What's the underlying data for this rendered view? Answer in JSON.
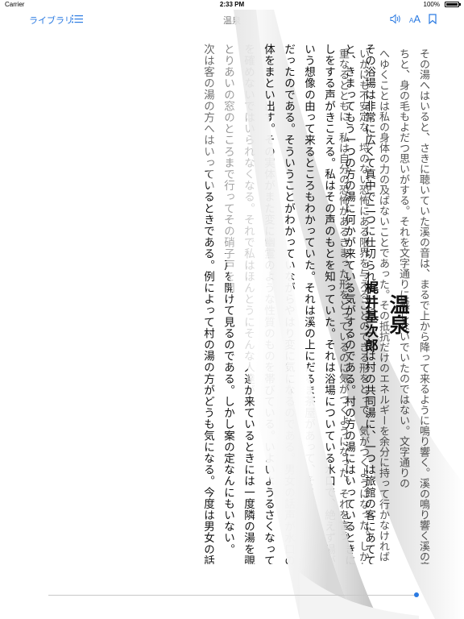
{
  "status": {
    "carrier": "Carrier",
    "time": "2:33 PM",
    "battery": "100%",
    "battery_level": 1.0
  },
  "nav": {
    "library_label": "ライブラリ",
    "title": "温泉",
    "font_label_small": "A",
    "font_label_large": "A"
  },
  "book": {
    "title": "温泉",
    "author": "梶井基次郎",
    "progress": 0.99,
    "lines": [
      "その浴場は非常に広くて真中で二つに仕切られていた。一つは村の共同湯に、一つは旅館の客にあててあった。私がそのどちらかにはいって",
      "と、きまってもう一つの方の湯に何かが来ている気がするのである。村の方の湯にはいっているときには、きまって客の湯の方に男女のぼそぼそ",
      "しをする声がきこえる。私はその声のもとを知っていた。それは浴場についている水口で、絶えず湯がほとばしり出ているのである。また男と",
      "いう想像の由って来るところもわかっていた。それは溪の上にだるま茶屋があって、そこの女が客と夜更けて湯へやって来ることがありうべきこと",
      "だったのである。そういうことがわかっていながらやはり変に気になるのである。男女の話声が水口の水の音だとわかっていながら、不可抗的に実",
      "体をまとい出す。その実体がまた変に幽霊のような性質のものを帯びている。いよいようるさくなって来ると私は自分の顔が変な顔になっていな",
      "を確めないではいられなくなる。それで私はほんとうにそんな人達が来ているときには一度隣の湯を覗いて見ないではいられないようにさえなる。",
      "とりあいの窓のところまで行ってその硝子戸を開けて見るのである。しかし案の定なんにもいない。",
      "次は客の湯の方へはいっているときである。例によって村の湯の方がどうも気になる。今度は男女の話声ではない。気になるのはさっきの溪への"
    ],
    "back_lines": [
      "その湯へはいると、さきに聴いていた溪の音は、まるで上から降って来るように鳴り響く。溪の鳴り響く溪の音ばかりが耳について、",
      "ちと、身の毛もよだつ思いがする。それを文字通りに感じないでいたのではない。文字通りの",
      "へゆくことは私の身体の力の及ばないことであった。その抵抗だけのエネルギーを余分に持って行かなければ",
      "いかにも不安定な、埒のない恐怖にある限界を与えることのできる形をとって、気がつくようになった。しかしそう",
      "重なるとともに、私は自分の恐怖があるきまった形をとっているのに気がつくようになった。それを言う"
    ]
  }
}
